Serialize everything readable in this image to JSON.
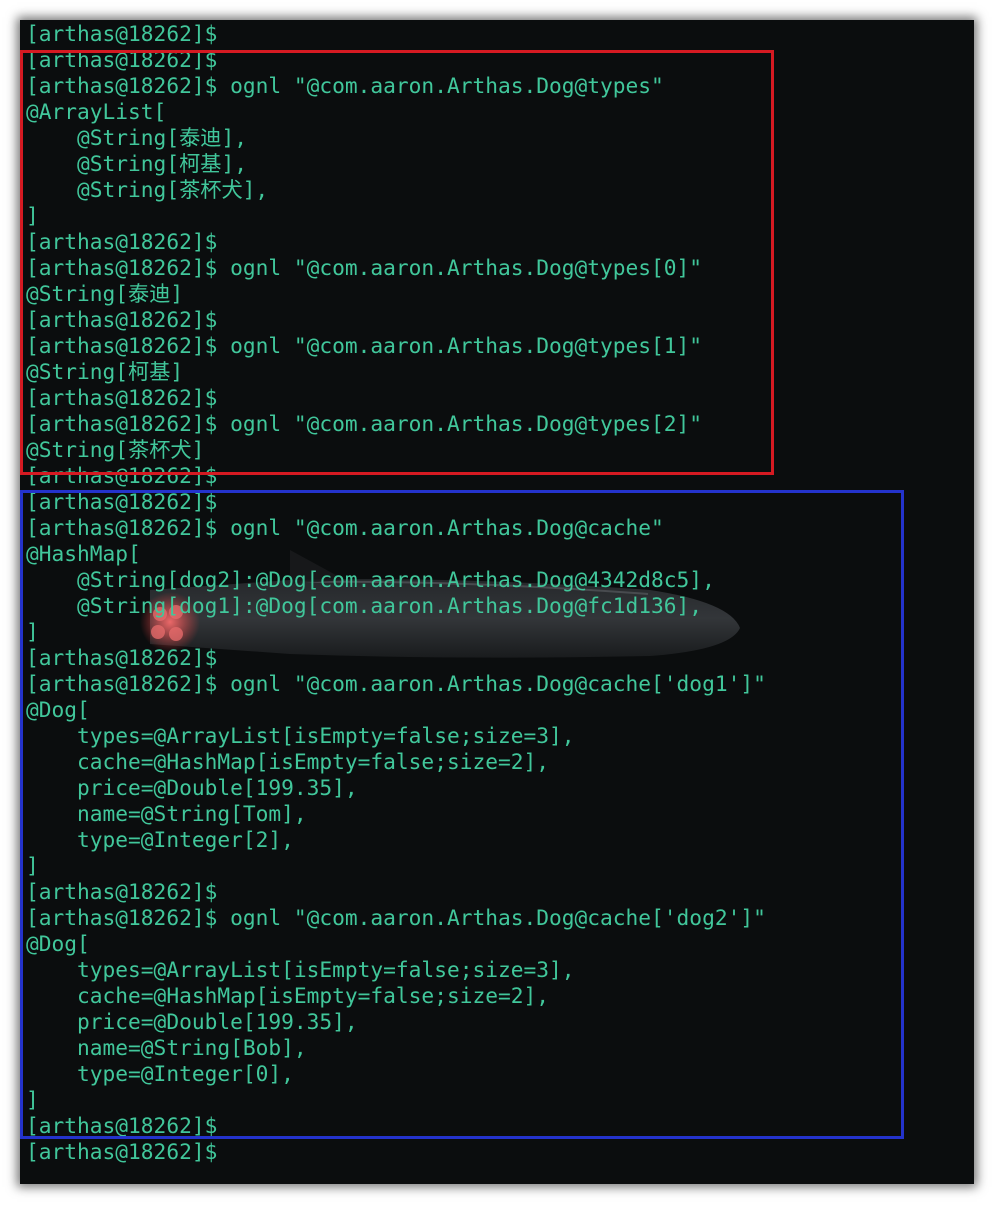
{
  "terminal": {
    "lines": [
      "[arthas@18262]$",
      "[arthas@18262]$",
      "[arthas@18262]$ ognl \"@com.aaron.Arthas.Dog@types\"",
      "@ArrayList[",
      "    @String[泰迪],",
      "    @String[柯基],",
      "    @String[茶杯犬],",
      "]",
      "[arthas@18262]$",
      "[arthas@18262]$ ognl \"@com.aaron.Arthas.Dog@types[0]\"",
      "@String[泰迪]",
      "[arthas@18262]$",
      "[arthas@18262]$ ognl \"@com.aaron.Arthas.Dog@types[1]\"",
      "@String[柯基]",
      "[arthas@18262]$",
      "[arthas@18262]$ ognl \"@com.aaron.Arthas.Dog@types[2]\"",
      "@String[茶杯犬]",
      "[arthas@18262]$",
      "[arthas@18262]$",
      "[arthas@18262]$ ognl \"@com.aaron.Arthas.Dog@cache\"",
      "@HashMap[",
      "    @String[dog2]:@Dog[com.aaron.Arthas.Dog@4342d8c5],",
      "    @String[dog1]:@Dog[com.aaron.Arthas.Dog@fc1d136],",
      "]",
      "[arthas@18262]$",
      "[arthas@18262]$ ognl \"@com.aaron.Arthas.Dog@cache['dog1']\"",
      "@Dog[",
      "    types=@ArrayList[isEmpty=false;size=3],",
      "    cache=@HashMap[isEmpty=false;size=2],",
      "    price=@Double[199.35],",
      "    name=@String[Tom],",
      "    type=@Integer[2],",
      "]",
      "[arthas@18262]$",
      "[arthas@18262]$ ognl \"@com.aaron.Arthas.Dog@cache['dog2']\"",
      "@Dog[",
      "    types=@ArrayList[isEmpty=false;size=3],",
      "    cache=@HashMap[isEmpty=false;size=2],",
      "    price=@Double[199.35],",
      "    name=@String[Bob],",
      "    type=@Integer[0],",
      "]",
      "[arthas@18262]$",
      "[arthas@18262]$"
    ]
  },
  "colors": {
    "terminal_background": "#0b0d0e",
    "terminal_text": "#41c79b",
    "highlight_red": "#d51a22",
    "highlight_blue": "#2433cc"
  }
}
